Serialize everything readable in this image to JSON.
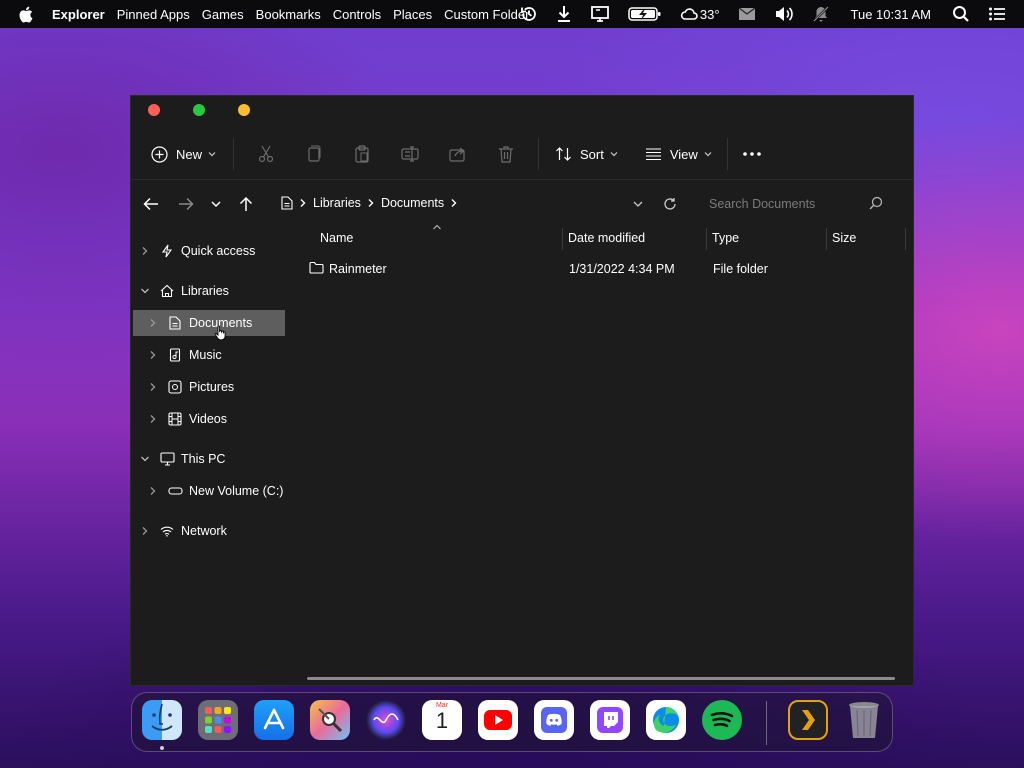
{
  "menubar": {
    "app_name": "Explorer",
    "menus": [
      "Pinned Apps",
      "Games",
      "Bookmarks",
      "Controls",
      "Places",
      "Custom Folder"
    ],
    "weather": "33°",
    "clock": "Tue 10:31 AM",
    "status_icons": [
      "history-icon",
      "download-icon",
      "display-icon",
      "battery-charging-icon",
      "weather-cloud-icon",
      "mail-icon",
      "volume-icon",
      "notifications-off-icon",
      "search-icon",
      "control-center-icon"
    ]
  },
  "window": {
    "traffic_colors": [
      "#ff5f57",
      "#28c840",
      "#febc2e"
    ],
    "toolbar": {
      "new_label": "New",
      "sort_label": "Sort",
      "view_label": "View",
      "disabled_icons": [
        "cut-icon",
        "copy-icon",
        "paste-icon",
        "rename-icon",
        "share-icon",
        "delete-icon"
      ]
    },
    "breadcrumb": [
      "Libraries",
      "Documents"
    ],
    "search_placeholder": "Search Documents",
    "sidebar": {
      "quick_access": "Quick access",
      "libraries": "Libraries",
      "documents": "Documents",
      "music": "Music",
      "pictures": "Pictures",
      "videos": "Videos",
      "this_pc": "This PC",
      "new_volume": "New Volume (C:)",
      "network": "Network"
    },
    "columns": {
      "name": "Name",
      "date": "Date modified",
      "type": "Type",
      "size": "Size"
    },
    "files": [
      {
        "name": "Rainmeter",
        "date": "1/31/2022 4:34 PM",
        "type": "File folder",
        "size": ""
      }
    ]
  },
  "dock": {
    "apps": [
      "Finder",
      "Launchpad",
      "App Store",
      "System Preferences",
      "Siri",
      "Calendar",
      "YouTube",
      "Discord",
      "Twitch",
      "Edge",
      "Spotify",
      "Plex",
      "Trash"
    ],
    "calendar_month": "Mar",
    "calendar_day": "1"
  },
  "colors": {
    "window_bg": "#1c1c1c",
    "selected_bg": "#5e5e5e",
    "accent_youtube": "#ff0000",
    "accent_spotify": "#1db954",
    "accent_plex": "#e5a00d"
  }
}
